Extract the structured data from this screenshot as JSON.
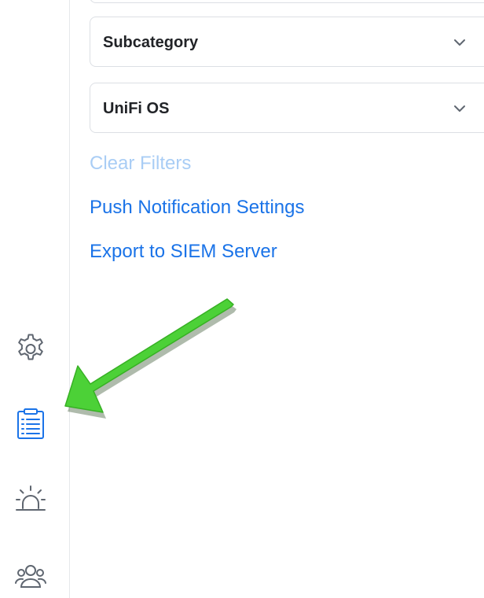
{
  "filters": {
    "subcategory_label": "Subcategory",
    "source_label": "UniFi OS"
  },
  "links": {
    "clear_filters": "Clear Filters",
    "push_notification_settings": "Push Notification Settings",
    "export_siem": "Export to SIEM Server"
  },
  "sidebar": {
    "icons": [
      "gear-icon",
      "clipboard-list-icon",
      "alarm-icon",
      "users-icon"
    ],
    "active_icon": "clipboard-list-icon"
  },
  "colors": {
    "link": "#1a73e8",
    "link_disabled": "#a9cdf5",
    "sidebar_icon": "#5f6670",
    "sidebar_icon_active": "#1a73e8",
    "annotation_arrow": "#4cd137"
  }
}
